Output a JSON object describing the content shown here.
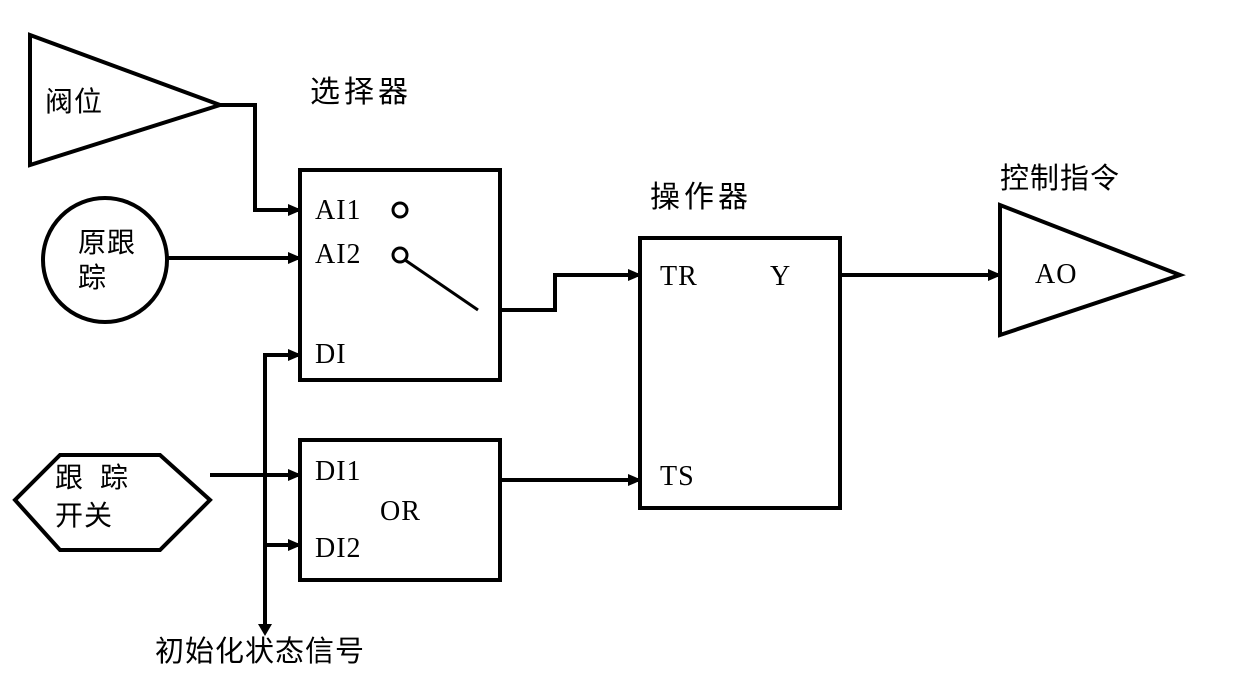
{
  "labels": {
    "valve_position": "阀位",
    "selector_title": "选择器",
    "original_track_line1": "原跟",
    "original_track_line2": "踪",
    "track_switch_line1": "跟  踪",
    "track_switch_line2": "开关",
    "operator_title": "操作器",
    "control_command": "控制指令",
    "init_state_signal": "初始化状态信号"
  },
  "selector_ports": {
    "ai1": "AI1",
    "ai2": "AI2",
    "di": "DI"
  },
  "or_block": {
    "di1": "DI1",
    "di2": "DI2",
    "op": "OR"
  },
  "operator_ports": {
    "tr": "TR",
    "y": "Y",
    "ts": "TS"
  },
  "output_block": {
    "ao": "AO"
  }
}
